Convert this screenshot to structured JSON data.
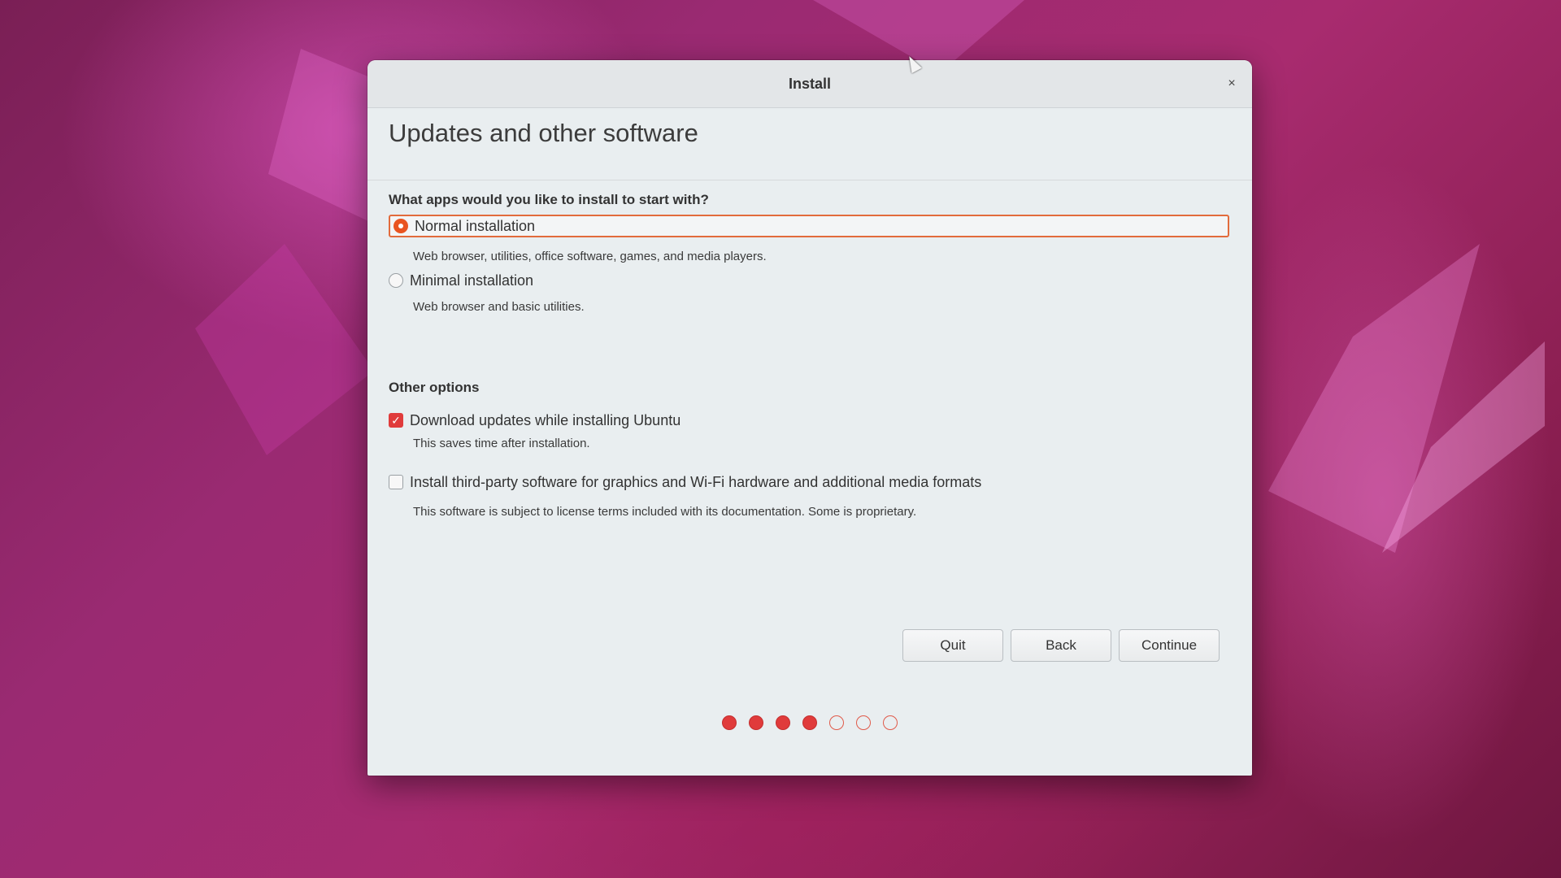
{
  "window": {
    "title": "Install",
    "close_glyph": "×"
  },
  "page": {
    "title": "Updates and other software"
  },
  "apps_question": "What apps would you like to install to start with?",
  "install_options": [
    {
      "label": "Normal installation",
      "description": "Web browser, utilities, office software, games, and media players.",
      "selected": true
    },
    {
      "label": "Minimal installation",
      "description": "Web browser and basic utilities.",
      "selected": false
    }
  ],
  "other_options_heading": "Other options",
  "other_options": [
    {
      "label": "Download updates while installing Ubuntu",
      "description": "This saves time after installation.",
      "checked": true
    },
    {
      "label": "Install third-party software for graphics and Wi-Fi hardware and additional media formats",
      "description": "This software is subject to license terms included with its documentation. Some is proprietary.",
      "checked": false
    }
  ],
  "buttons": {
    "quit": "Quit",
    "back": "Back",
    "continue": "Continue"
  },
  "progress": {
    "completed_steps": 4,
    "total_steps": 7
  },
  "colors": {
    "accent": "#e95420",
    "checkbox_checked": "#e03b3b",
    "selection_border": "#e26b3c"
  },
  "icons": {
    "close": "close-icon",
    "cursor": "mouse-pointer-icon"
  }
}
